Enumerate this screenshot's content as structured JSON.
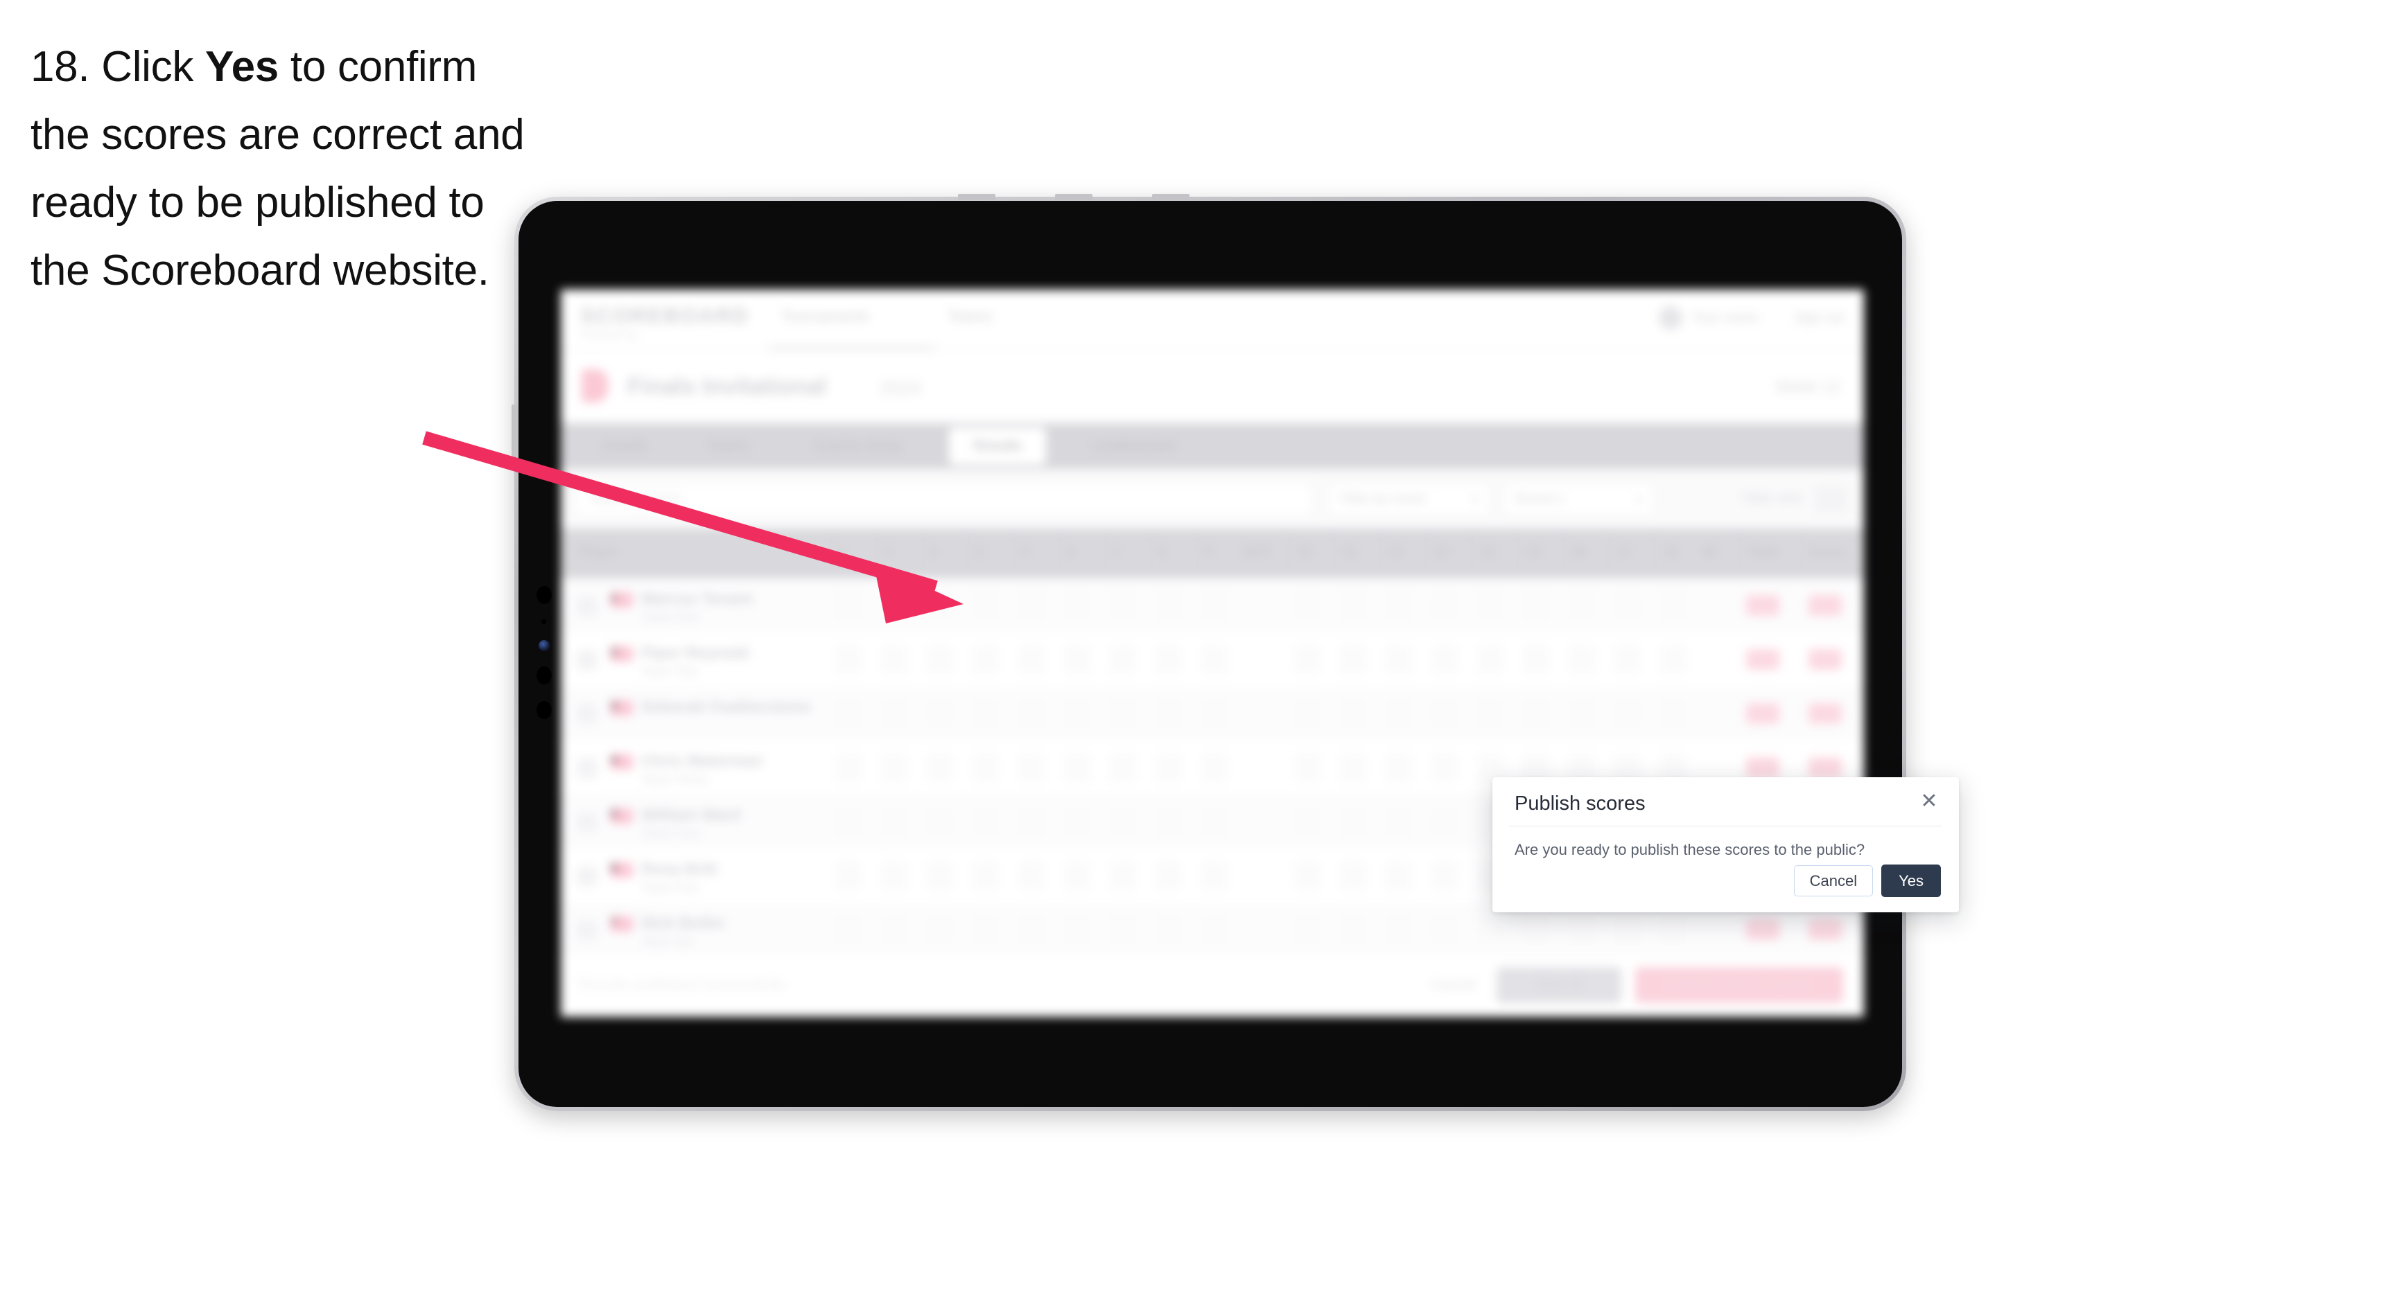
{
  "caption": {
    "step_number": "18.",
    "text_before": " Click ",
    "emphasis": "Yes",
    "text_after": " to confirm the scores are correct and ready to be published to the Scoreboard website."
  },
  "modal": {
    "title": "Publish scores",
    "close_icon": "close-x-icon",
    "body": "Are you ready to publish these scores to the public?",
    "cancel_label": "Cancel",
    "yes_label": "Yes"
  },
  "colors": {
    "arrow": "#ef2e5f",
    "primary_button": "#2e3a4e",
    "cancel_border": "#c8d8ef",
    "accent_pink": "#fbc9d5",
    "tablet_bezel": "#c3c3c8",
    "screen_black": "#0b0b0c"
  },
  "background_app": {
    "header": {
      "logo_wordmark": "SCOREBOARD",
      "logo_sub": "Powered by",
      "logo_sub_pill": "",
      "nav": [
        "Tournaments",
        "Teams"
      ],
      "avatar_icon": "user-avatar-icon",
      "links": [
        "Your name",
        "Sign out"
      ]
    },
    "title_bar": {
      "icon": "trophy-icon",
      "title": "Finals Invitational",
      "subtitle": "2024",
      "right_meta": "Week 12"
    },
    "tabs": [
      {
        "label": "Details",
        "active": false
      },
      {
        "label": "Teams",
        "active": false
      },
      {
        "label": "Course Setup",
        "active": false
      },
      {
        "label": "Results",
        "active": true
      },
      {
        "label": "Leaderboard",
        "active": false
      }
    ],
    "filters": {
      "search_placeholder": "Search players",
      "selects": [
        {
          "label": "Filter by round"
        },
        {
          "label": "Round 1"
        }
      ],
      "view_label": "Table view",
      "view_toggle_icon": "grid-toggle-icon"
    },
    "table": {
      "columns": [
        "Player",
        "1",
        "2",
        "3",
        "4",
        "5",
        "6",
        "7",
        "8",
        "9",
        "OUT",
        "10",
        "11",
        "12",
        "13",
        "14",
        "15",
        "16",
        "17",
        "18",
        "IN",
        "Total",
        "Score"
      ],
      "rows": [
        {
          "rank": "1",
          "name": "Marcus Tenant",
          "sub": "Team One"
        },
        {
          "rank": "2",
          "name": "Piper Reynold",
          "sub": "Team Two"
        },
        {
          "rank": "3",
          "name": "Deborah Featherstone",
          "sub": ""
        },
        {
          "rank": "4",
          "name": "Chris Waterman",
          "sub": "Team Three"
        },
        {
          "rank": "5",
          "name": "William Ward",
          "sub": "Team Four"
        },
        {
          "rank": "6",
          "name": "Rosa Britt",
          "sub": "Team Five"
        },
        {
          "rank": "7",
          "name": "Nick Butler",
          "sub": "Team Six"
        }
      ]
    },
    "footer": {
      "note": "Results published successfully",
      "link_label": "Cancel",
      "secondary_button": "Save all",
      "primary_button": "Publish scores to public"
    }
  }
}
